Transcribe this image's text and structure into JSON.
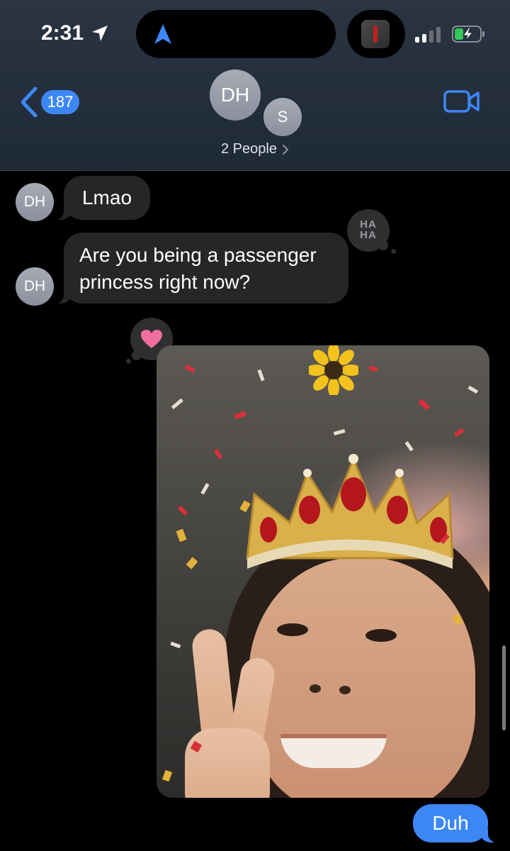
{
  "status_bar": {
    "time": "2:31",
    "icons": [
      "location-arrow-icon",
      "navigation-icon",
      "camera-thumbnail-icon",
      "signal-icon",
      "battery-charging-icon"
    ]
  },
  "header": {
    "back_count": "187",
    "avatar_primary": "DH",
    "avatar_secondary": "S",
    "group_label": "2 People",
    "icons": [
      "back-chevron-icon",
      "facetime-video-icon",
      "chevron-right-icon"
    ]
  },
  "messages": [
    {
      "sender": "DH",
      "direction": "incoming",
      "text": "Lmao"
    },
    {
      "sender": "DH",
      "direction": "incoming",
      "text": "Are you being a passenger princess right now?",
      "tapback_line1": "HA",
      "tapback_line2": "HA"
    },
    {
      "direction": "outgoing",
      "type": "photo",
      "tapback": "heart-icon"
    },
    {
      "direction": "outgoing",
      "text": "Duh"
    }
  ],
  "colors": {
    "accent": "#3d87f5",
    "incoming_bubble": "#262628",
    "header_bg": "#253040",
    "heart": "#f06e9e"
  }
}
